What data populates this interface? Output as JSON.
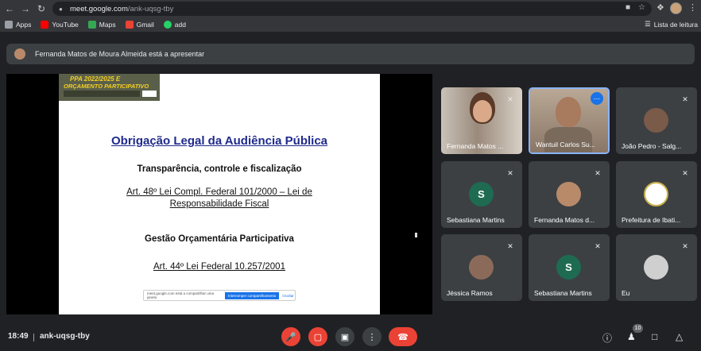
{
  "browser": {
    "url_host": "meet.google.com",
    "url_path": "/ank-uqsg-tby",
    "back_icon": "arrow-left-icon",
    "forward_icon": "arrow-right-icon",
    "reload_icon": "reload-icon"
  },
  "bookmarks": [
    {
      "label": "Apps",
      "color": "#e8eaed"
    },
    {
      "label": "YouTube",
      "color": "#ff0000"
    },
    {
      "label": "Maps",
      "color": "#34a853"
    },
    {
      "label": "Gmail",
      "color": "#ea4335"
    },
    {
      "label": "add",
      "color": "#25d366"
    }
  ],
  "reading_list": "Lista de leitura",
  "banner": {
    "text": "Fernanda Matos de Moura Almeida está a apresentar"
  },
  "slide": {
    "logo_line1": "PPA 2022/2025 E",
    "logo_line2": "ORÇAMENTO PARTICIPATIVO",
    "title": "Obrigação Legal da Audiência Pública",
    "line1": "Transparência, controle e fiscalização",
    "line2a": "Art. 48º   Lei Compl. Federal 101/2000 – Lei de",
    "line2b": "Responsabilidade Fiscal",
    "line3": "Gestão Orçamentária Participativa",
    "line4": "Art. 44º   Lei Federal 10.257/2001",
    "share_text": "meet.google.com está a compartilhar uma janela",
    "share_button": "Interromper compartilhamento",
    "share_hide": "Ocultar"
  },
  "participants": [
    {
      "name": "Fernanda Matos ...",
      "type": "video"
    },
    {
      "name": "Wantuil Carlos Su...",
      "type": "video",
      "active": true
    },
    {
      "name": "João Pedro - Salg...",
      "type": "avatar",
      "avatar_color": "#7a5a48"
    },
    {
      "name": "Sebastiana Martins",
      "type": "letter",
      "letter": "S",
      "avatar_color": "#1e6b52"
    },
    {
      "name": "Fernanda Matos d...",
      "type": "avatar",
      "avatar_color": "#b88a6a"
    },
    {
      "name": "Prefeitura de Ibati...",
      "type": "avatar",
      "avatar_color": "#ffffff"
    },
    {
      "name": "Jéssica Ramos",
      "type": "avatar",
      "avatar_color": "#8c6a5a"
    },
    {
      "name": "Sebastiana Martins",
      "type": "letter",
      "letter": "S",
      "avatar_color": "#1e6b52"
    },
    {
      "name": "Eu",
      "type": "avatar",
      "avatar_color": "#cfcfcf"
    }
  ],
  "bottom": {
    "time": "18:49",
    "meeting_code": "ank-uqsg-tby",
    "people_count": "10"
  },
  "colors": {
    "danger": "#ea4335",
    "accent": "#1a73e8",
    "bg": "#202124"
  }
}
